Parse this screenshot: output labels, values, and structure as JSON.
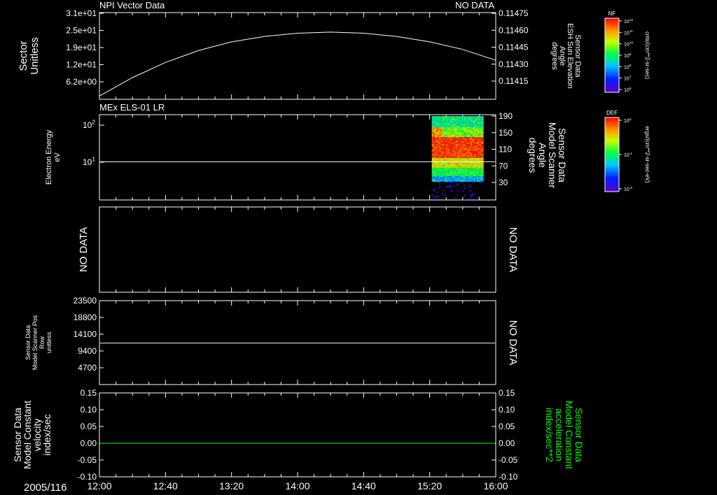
{
  "date_label": "2005/116",
  "time_ticks": [
    "12:00",
    "12:40",
    "13:20",
    "14:00",
    "14:40",
    "15:20",
    "16:00"
  ],
  "colors": {
    "axis": "#ffffff",
    "curve": "#ffffff",
    "green": "#00ff00",
    "background": "#000000"
  },
  "panels": {
    "p1": {
      "title_left": "NPI Vector Data",
      "title_right": "NO DATA",
      "left_label": [
        "Sector",
        "Unitless"
      ],
      "left_ticks": [
        "3.1e+01",
        "2.5e+01",
        "1.9e+01",
        "1.2e+01",
        "6.2e+00"
      ],
      "right_label": [
        "Sensor Data",
        "ESH Sun Elevation",
        "Angle",
        "degrees"
      ],
      "right_ticks": [
        "0.11475",
        "0.11460",
        "0.11445",
        "0.11430",
        "0.11415"
      ]
    },
    "p2": {
      "title_left": "MEx ELS-01 LR",
      "left_label": [
        "Electron Energy",
        "eV"
      ],
      "left_ticks": [
        "10^2",
        "10^1"
      ],
      "right_label": [
        "Sensor Data",
        "Model Scanner",
        "Angle",
        "degrees"
      ],
      "right_ticks": [
        "190",
        "150",
        "110",
        "70",
        "30"
      ]
    },
    "p3": {
      "left_label": [
        "NO DATA"
      ],
      "right_label": [
        "NO DATA"
      ]
    },
    "p4": {
      "left_label": [
        "Sensor Data",
        "Model Scanner Pos",
        "Row",
        "unitless"
      ],
      "left_ticks": [
        "23500",
        "18800",
        "14100",
        "9400",
        "4700"
      ],
      "right_label": [
        "NO DATA"
      ]
    },
    "p5": {
      "left_label": [
        "Sensor Data",
        "Model Constant",
        "velocity",
        "index/sec"
      ],
      "left_ticks": [
        "0.15",
        "0.10",
        "0.05",
        "0.00",
        "-0.05",
        "-0.10"
      ],
      "right_label": [
        "Sensor Data",
        "Model Constant",
        "acceleration",
        "index/sec**2"
      ],
      "right_ticks": [
        "0.15",
        "0.10",
        "0.05",
        "0.00",
        "-0.05",
        "-0.10"
      ]
    }
  },
  "colorbars": [
    {
      "top_label": "NF",
      "unit": "cnts/(cm**2-sr-sec)",
      "ticks": [
        "10^12",
        "10^11",
        "10^10",
        "10^9",
        "10^8",
        "10^7",
        "10^6"
      ]
    },
    {
      "top_label": "DEF",
      "unit": "ergs/(cm**2-sr-sec-eV)",
      "ticks": [
        "10^0",
        "10^-1",
        "10^-2"
      ]
    }
  ],
  "chart_data": [
    {
      "type": "line",
      "panel": "p1",
      "title": "NPI Vector Data",
      "xlabel": "2005/116",
      "x": [
        "12:00",
        "12:20",
        "12:40",
        "13:00",
        "13:20",
        "13:40",
        "14:00",
        "14:20",
        "14:40",
        "15:00",
        "15:20",
        "15:40",
        "16:00"
      ],
      "y": [
        0.11403,
        0.1142,
        0.11434,
        0.11445,
        0.11453,
        0.11458,
        0.11461,
        0.11462,
        0.11461,
        0.11458,
        0.11453,
        0.11446,
        0.11436
      ],
      "ylabel": "Sensor Data ESH Sun Elevation Angle degrees",
      "ylim": [
        0.114,
        0.1148
      ]
    },
    {
      "type": "heatmap",
      "panel": "p2",
      "title": "MEx ELS-01 LR",
      "ylabel": "Electron Energy eV",
      "yscale": "log",
      "data_range_x": [
        "15:20",
        "16:00"
      ],
      "reference_line": {
        "y2": 80,
        "label": "Model Scanner Angle"
      }
    },
    {
      "type": "line",
      "panel": "p4",
      "ylabel": "Sensor Data Model Scanner Pos Row unitless",
      "x": [
        "12:00",
        "16:00"
      ],
      "y": [
        11600,
        11600
      ],
      "ylim": [
        0,
        23500
      ]
    },
    {
      "type": "line",
      "panel": "p5",
      "ylabel": "Sensor Data Model Constant velocity index/sec",
      "x": [
        "12:00",
        "16:00"
      ],
      "y": [
        0.0,
        0.0
      ],
      "ylim": [
        -0.1,
        0.15
      ]
    }
  ]
}
